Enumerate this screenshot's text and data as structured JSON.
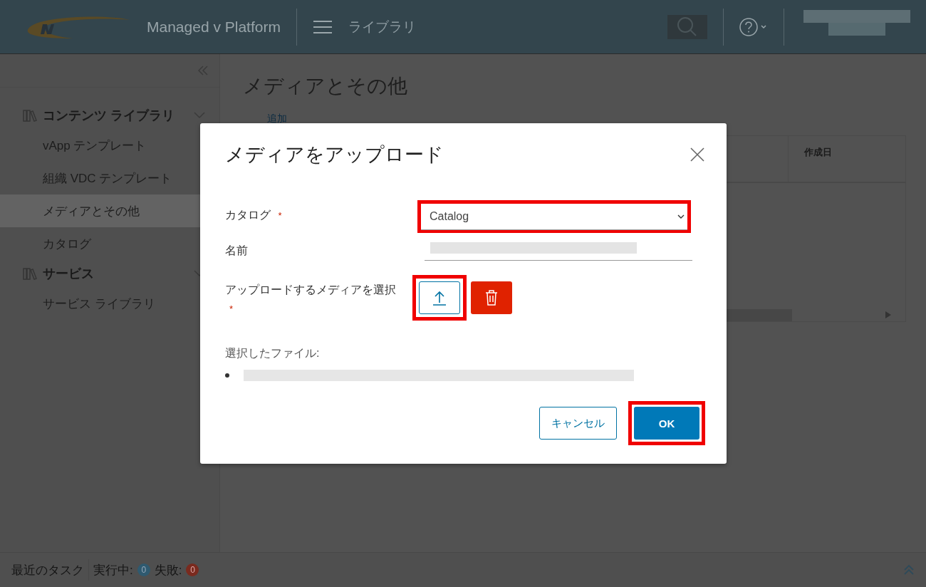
{
  "header": {
    "brand": "Managed v Platform",
    "section": "ライブラリ",
    "user_redacted": true
  },
  "sidebar": {
    "groups": [
      {
        "label": "コンテンツ ライブラリ",
        "expanded": true,
        "items": [
          {
            "label": "vApp テンプレート",
            "selected": false
          },
          {
            "label": "組織 VDC テンプレート",
            "selected": false
          },
          {
            "label": "メディアとその他",
            "selected": true
          },
          {
            "label": "カタログ",
            "selected": false
          }
        ]
      },
      {
        "label": "サービス",
        "expanded": true,
        "items": [
          {
            "label": "サービス ライブラリ",
            "selected": false
          }
        ]
      }
    ]
  },
  "page": {
    "title": "メディアとその他",
    "add_link": "追加",
    "table": {
      "columns": [
        "作成日"
      ]
    }
  },
  "dialog": {
    "title": "メディアをアップロード",
    "fields": [
      {
        "kind": "select",
        "label": "カタログ",
        "required_mark": "*",
        "value": "Catalog",
        "highlighted": true
      },
      {
        "kind": "text",
        "label": "名前",
        "redacted": true
      },
      {
        "kind": "file",
        "label": "アップロードするメディアを選択",
        "required_mark": "*",
        "highlighted": true
      }
    ],
    "selected_files_label": "選択したファイル:",
    "selected_files": [
      {
        "redacted": true
      }
    ],
    "buttons": [
      {
        "label": "キャンセル",
        "kind": "secondary",
        "highlighted": false
      },
      {
        "label": "OK",
        "kind": "primary",
        "highlighted": true
      }
    ]
  },
  "status_bar": {
    "label": "最近のタスク",
    "running_label": "実行中:",
    "running_count": "0",
    "failed_label": "失敗:",
    "failed_count": "0"
  }
}
